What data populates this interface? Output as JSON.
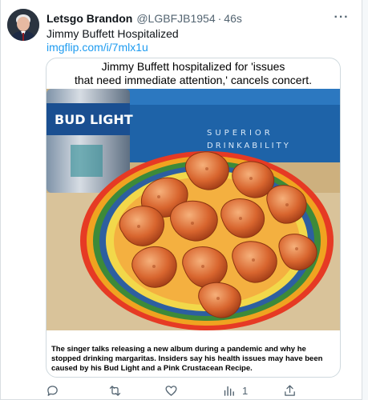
{
  "tweet": {
    "author_name": "Letsgo Brandon",
    "handle": "@LGBFJB1954",
    "separator": "·",
    "time": "46s",
    "more_label": "···",
    "text": "Jimmy Buffett Hospitalized",
    "link": "imgflip.com/i/7mlx1u"
  },
  "meme": {
    "title_line1": "Jimmy Buffett hospitalized for 'issues",
    "title_line2": "that need immediate attention,' cancels concert.",
    "can_text": "BUD LIGHT",
    "box_text_1": "SUPERIOR",
    "box_text_2": "DRINKABILITY",
    "caption": "The singer talks releasing a new album during a pandemic and why he stopped drinking margaritas. Insiders say his health issues may have been caused by his Bud Light and a Pink Crustacean Recipe."
  },
  "actions": {
    "views_count": "1"
  },
  "icons": [
    "reply-icon",
    "retweet-icon",
    "like-icon",
    "views-icon",
    "share-icon",
    "more-icon"
  ],
  "colors": {
    "link": "#1d9bf0",
    "muted": "#536471",
    "text": "#0f1419",
    "border": "#cfd9de"
  }
}
